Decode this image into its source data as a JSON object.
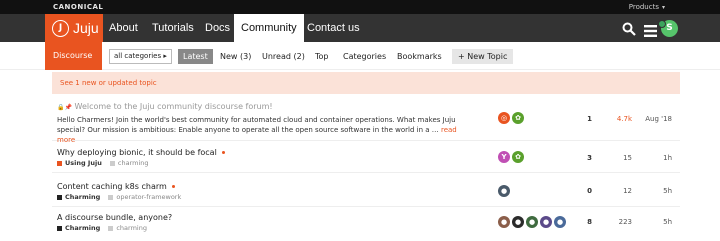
{
  "canonical": {
    "logo": "CANONICAL",
    "products": "Products",
    "caret": "▾"
  },
  "nav": {
    "logo_text": "Juju",
    "logo_glyph": "J",
    "links": [
      "About",
      "Tutorials",
      "Docs",
      "Community",
      "Contact us"
    ],
    "active": "Community",
    "user_initial": "S"
  },
  "subnav": {
    "brand": "Discourse",
    "category_select": "all categories ▸",
    "tabs": [
      "Latest",
      "New (3)",
      "Unread (2)",
      "Top",
      "Categories",
      "Bookmarks"
    ],
    "active_tab": "Latest",
    "new_topic": "+ New Topic"
  },
  "alert": "See 1 new or updated topic",
  "topics": [
    {
      "pin": "🔒📌",
      "title": "Welcome to the Juju community discourse forum!",
      "excerpt": "Hello Charmers! Join the world's best community for automated cloud and container operations. What makes Juju special? Our mission is ambitious: Enable anyone to operate all the open source software in the world in a …",
      "read_more": "read more",
      "replies": "1",
      "views": "4.7k",
      "activity": "Aug '18"
    },
    {
      "title": "Why deploying bionic,  it should be focal",
      "category": "Using Juju",
      "tag": "charming",
      "replies": "3",
      "views": "15",
      "activity": "1h"
    },
    {
      "title": "Content caching k8s charm",
      "category": "Charming",
      "tag": "operator-framework",
      "replies": "0",
      "views": "12",
      "activity": "5h"
    },
    {
      "title": "A discourse bundle, anyone?",
      "category": "Charming",
      "tag": "charming",
      "replies": "8",
      "views": "223",
      "activity": "5h"
    }
  ],
  "colors": {
    "accent": "#e95420",
    "topbar": "#333333",
    "using_juju": "#e95420",
    "charming": "#222222"
  }
}
